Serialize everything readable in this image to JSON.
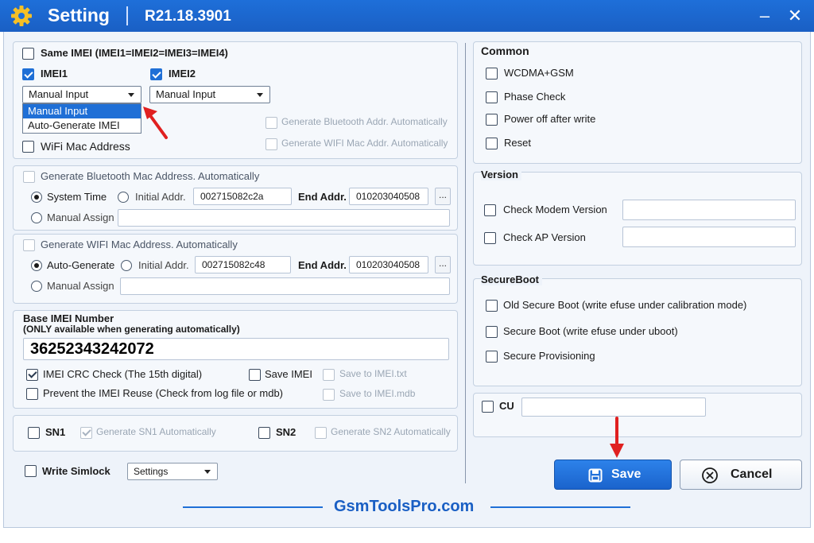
{
  "window": {
    "title": "Setting",
    "version": "R21.18.3901",
    "minimize_label": "–",
    "close_label": "✕"
  },
  "imei": {
    "same_imei_label": "Same IMEI (IMEI1=IMEI2=IMEI3=IMEI4)",
    "imei1_label": "IMEI1",
    "imei2_label": "IMEI2",
    "imei1_mode": "Manual Input",
    "imei2_mode": "Manual Input",
    "dropdown_options": [
      "Manual Input",
      "Auto-Generate IMEI"
    ],
    "wifi_mac_label": "WiFi Mac Address",
    "gen_bt_label": "Generate Bluetooth Addr. Automatically",
    "gen_wifi_label": "Generate WIFI Mac Addr. Automatically"
  },
  "bt": {
    "header": "Generate Bluetooth Mac Address. Automatically",
    "opt1": "System Time",
    "opt2": "Initial Addr.",
    "start": "002715082c2a",
    "end_label": "End Addr.",
    "end": "010203040508",
    "dots": "...",
    "manual": "Manual Assign"
  },
  "wifi": {
    "header": "Generate WIFI Mac Address. Automatically",
    "opt1": "Auto-Generate",
    "opt2": "Initial Addr.",
    "start": "002715082c48",
    "end_label": "End Addr.",
    "end": "010203040508",
    "dots": "...",
    "manual": "Manual Assign"
  },
  "base": {
    "title": "Base IMEI Number",
    "note": "(ONLY available when generating automatically)",
    "value": "36252343242072",
    "crc_label": "IMEI CRC Check (The 15th digital)",
    "save_imei": "Save IMEI",
    "save_txt": "Save to IMEI.txt",
    "reuse_label": "Prevent the IMEI Reuse (Check from log file or mdb)",
    "save_mdb": "Save to IMEI.mdb"
  },
  "sn": {
    "sn1": "SN1",
    "gen_sn1": "Generate SN1 Automatically",
    "sn2": "SN2",
    "gen_sn2": "Generate SN2 Automatically"
  },
  "simlock": {
    "label": "Write Simlock",
    "dropdown": "Settings"
  },
  "common": {
    "title": "Common",
    "items": [
      "WCDMA+GSM",
      "Phase Check",
      "Power off after write",
      "Reset"
    ]
  },
  "version": {
    "title": "Version",
    "modem": "Check Modem Version",
    "ap": "Check AP Version"
  },
  "secureboot": {
    "title": "SecureBoot",
    "items": [
      "Old Secure Boot (write efuse under calibration mode)",
      "Secure Boot (write efuse under uboot)",
      "Secure Provisioning"
    ]
  },
  "cu": {
    "label": "CU"
  },
  "buttons": {
    "save": "Save",
    "cancel": "Cancel"
  },
  "footer": {
    "brand": "GsmToolsPro.com"
  },
  "colors": {
    "accent": "#1f6fd6",
    "annotation_arrow": "#e02020"
  }
}
